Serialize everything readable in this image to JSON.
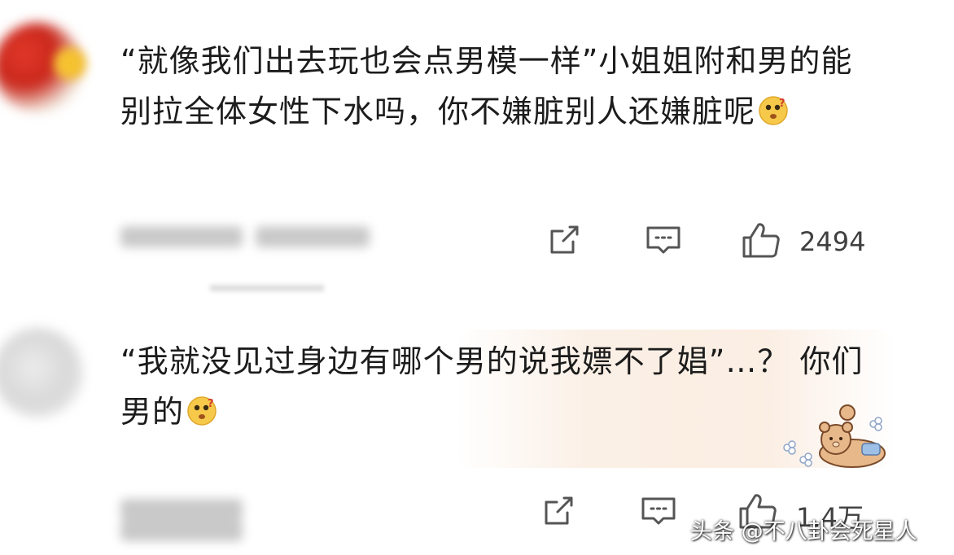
{
  "comments": [
    {
      "text": "“就像我们出去玩也会点男模一样”小姐姐附和男的能别拉全体女性下水吗，你不嫌脏别人还嫌脏呢",
      "emoji": "thinking-face-icon",
      "likes": "2494"
    },
    {
      "text": "“我就没见过身边有哪个男的说我嫖不了娼”…？ 你们男的",
      "emoji": "thinking-face-icon",
      "likes": "1.4万"
    }
  ],
  "watermark": "头条 @不八卦会死星人",
  "colors": {
    "text": "#1c1c1c",
    "icon": "#555555",
    "count": "#3f3f3f"
  }
}
